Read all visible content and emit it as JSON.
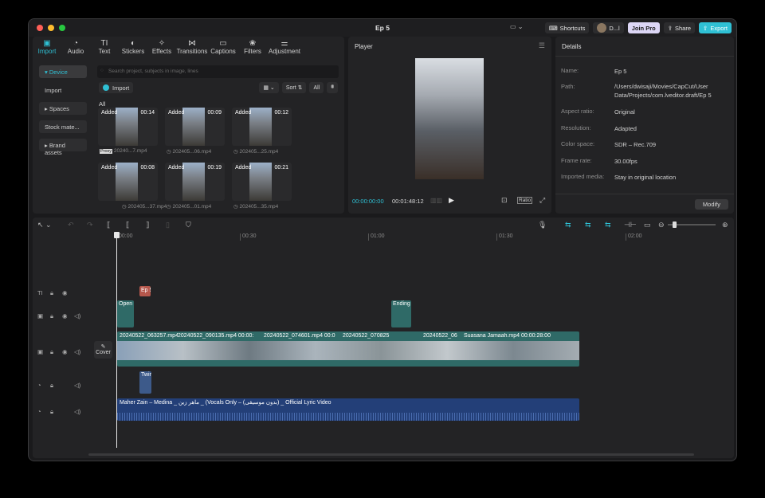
{
  "window": {
    "title": "Ep 5"
  },
  "titlebar": {
    "shortcuts_label": "Shortcuts",
    "user_label": "D...l",
    "join_pro_label": "Join Pro",
    "share_label": "Share",
    "export_label": "Export"
  },
  "media_toolbar": [
    {
      "label": "Import",
      "icon": "import-icon"
    },
    {
      "label": "Audio",
      "icon": "audio-icon"
    },
    {
      "label": "Text",
      "icon": "text-icon"
    },
    {
      "label": "Stickers",
      "icon": "stickers-icon"
    },
    {
      "label": "Effects",
      "icon": "effects-icon"
    },
    {
      "label": "Transitions",
      "icon": "transitions-icon"
    },
    {
      "label": "Captions",
      "icon": "captions-icon"
    },
    {
      "label": "Filters",
      "icon": "filters-icon"
    },
    {
      "label": "Adjustment",
      "icon": "adjustment-icon"
    }
  ],
  "sidebar": {
    "items": [
      {
        "label": "▾ Device"
      },
      {
        "label": "Import"
      },
      {
        "label": "▸ Spaces"
      },
      {
        "label": "Stock mate..."
      },
      {
        "label": "▸ Brand assets"
      }
    ]
  },
  "search": {
    "placeholder": "Search project, subjects in image, lines"
  },
  "import_button": "Import",
  "view_controls": {
    "sort_label": "Sort",
    "all_label": "All"
  },
  "all_label": "All",
  "clips": [
    {
      "added": "Added",
      "duration": "00:14",
      "name": "20240...7.mp4",
      "proxy": "Proxy"
    },
    {
      "added": "Added",
      "duration": "00:09",
      "name": "202405...06.mp4"
    },
    {
      "added": "Added",
      "duration": "00:12",
      "name": "202405...25.mp4"
    },
    {
      "added": "Added",
      "duration": "00:08",
      "name": "202405...37.mp4"
    },
    {
      "added": "Added",
      "duration": "00:19",
      "name": "202405...01.mp4"
    },
    {
      "added": "Added",
      "duration": "00:21",
      "name": "202405...35.mp4"
    }
  ],
  "player": {
    "title": "Player",
    "current_time": "00:00:00:00",
    "total_time": "00:01:48:12",
    "ratio_label": "Ratio"
  },
  "details": {
    "title": "Details",
    "rows": [
      {
        "label": "Name:",
        "value": "Ep 5"
      },
      {
        "label": "Path:",
        "value": "/Users/dwisaji/Movies/CapCut/User Data/Projects/com.lveditor.draft/Ep 5"
      },
      {
        "label": "Aspect ratio:",
        "value": "Original"
      },
      {
        "label": "Resolution:",
        "value": "Adapted"
      },
      {
        "label": "Color space:",
        "value": "SDR – Rec.709"
      },
      {
        "label": "Frame rate:",
        "value": "30.00fps"
      },
      {
        "label": "Imported media:",
        "value": "Stay in original location"
      }
    ],
    "modify_label": "Modify"
  },
  "timeline": {
    "ruler": [
      "00:00",
      "00:30",
      "01:00",
      "01:30",
      "02:00"
    ],
    "cover_label": "Cover",
    "text_clip": "Ep 5",
    "overlay_clips": [
      "Open",
      "Ending"
    ],
    "main_clips": [
      "20240522_063257.mp4",
      "20240522_090135.mp4  00:00:",
      "20240522_074601.mp4  00:0",
      "20240522_070825",
      "20240522_06",
      "Suasana Jamaah.mp4  00:00:28:00"
    ],
    "audio_clip_short": "Twin",
    "audio_clip": "Maher Zain – Medina _ ماهر زين _ (Vocals Only – (بدون موسيقى) _ Official Lyric Video"
  }
}
